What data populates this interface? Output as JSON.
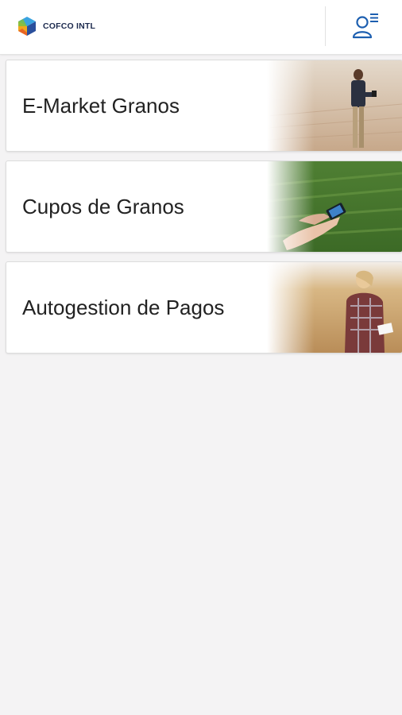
{
  "header": {
    "brand_name": "COFCO INTL",
    "logo_icon": "cofco-cube-logo",
    "user_menu_icon": "user-menu-icon",
    "accent_color": "#1d5fb0"
  },
  "menu": {
    "cards": [
      {
        "label": "E-Market Granos",
        "photo": "farmer-with-tablet-in-field"
      },
      {
        "label": "Cupos de Granos",
        "photo": "hand-holding-phone-over-crops"
      },
      {
        "label": "Autogestion de Pagos",
        "photo": "woman-on-phone-in-wheat-field"
      }
    ]
  },
  "colors": {
    "background": "#f4f3f4",
    "card": "#ffffff",
    "text": "#222222"
  }
}
